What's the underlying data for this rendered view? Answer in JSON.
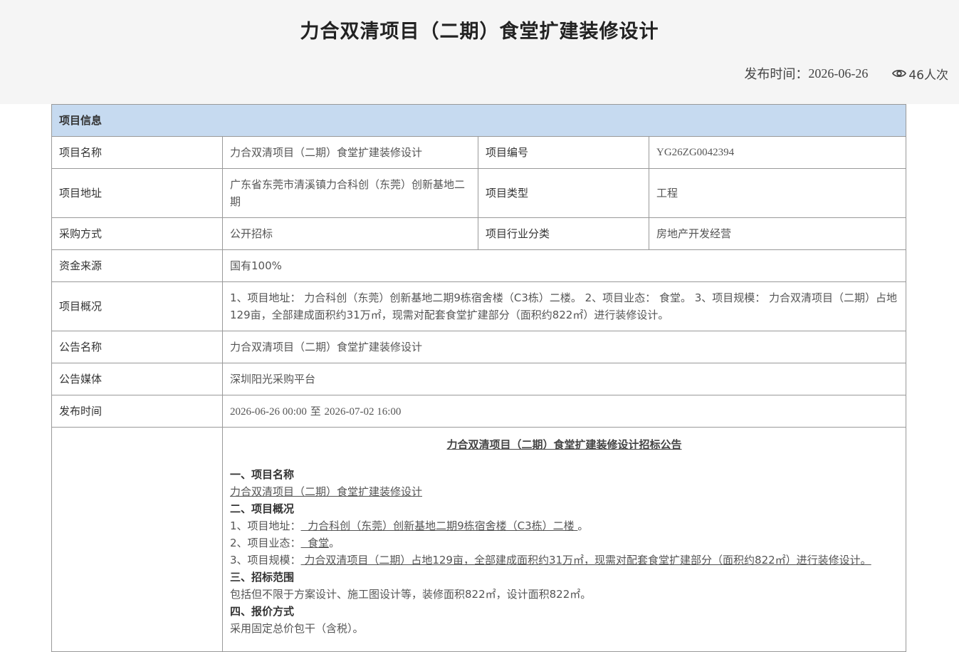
{
  "header": {
    "title": "力合双清项目（二期）食堂扩建装修设计",
    "publish_label": "发布时间：",
    "publish_date": "2026-06-26",
    "views": "46人次"
  },
  "info": {
    "section_title": "项目信息",
    "project_name_label": "项目名称",
    "project_name": "力合双清项目（二期）食堂扩建装修设计",
    "project_no_label": "项目编号",
    "project_no": "YG26ZG0042394",
    "address_label": "项目地址",
    "address": "广东省东莞市清溪镇力合科创（东莞）创新基地二期",
    "type_label": "项目类型",
    "type": "工程",
    "purchase_label": "采购方式",
    "purchase": "公开招标",
    "industry_label": "项目行业分类",
    "industry": "房地产开发经营",
    "fund_label": "资金来源",
    "fund": "国有100%",
    "overview_label": "项目概况",
    "overview": "1、项目地址： 力合科创（东莞）创新基地二期9栋宿舍楼（C3栋）二楼。 2、项目业态： 食堂。 3、项目规模： 力合双清项目（二期）占地129亩，全部建成面积约31万㎡，现需对配套食堂扩建部分（面积约822㎡）进行装修设计。",
    "notice_name_label": "公告名称",
    "notice_name": "力合双清项目（二期）食堂扩建装修设计",
    "media_label": "公告媒体",
    "media": "深圳阳光采购平台",
    "time_label": "发布时间",
    "time_start": "2026-06-26 00:00",
    "time_sep": "至",
    "time_end": "2026-07-02 16:00"
  },
  "notice": {
    "title": "力合双清项目（二期）食堂扩建装修设计招标公告",
    "s1_title": "一、项目名称",
    "s1_text": "力合双清项目（二期）食堂扩建装修设计",
    "s2_title": "二、项目概况",
    "s2_l1_prefix": "1、项目地址：",
    "s2_l1_value": "  力合科创（东莞）创新基地二期9栋宿舍楼（C3栋）二楼 ",
    "s2_l1_suffix": "。",
    "s2_l2_prefix": "2、项目业态：",
    "s2_l2_value": "  食堂",
    "s2_l2_suffix": "。",
    "s2_l3_prefix": "3、项目规模：",
    "s2_l3_value": " 力合双清项目（二期）占地129亩，全部建成面积约31万㎡，现需对配套食堂扩建部分（面积约822㎡）进行装修设计。 ",
    "s3_title": "三、招标范围",
    "s3_text": "包括但不限于方案设计、施工图设计等，装修面积822㎡，设计面积822㎡。",
    "s4_title": "四、报价方式",
    "s4_text": "采用固定总价包干（含税）。"
  },
  "colors": {
    "header_bg": "#f5f5f5",
    "section_head_bg": "#c6daf0",
    "border": "#999999"
  },
  "icons": {
    "views": "eye-icon"
  }
}
